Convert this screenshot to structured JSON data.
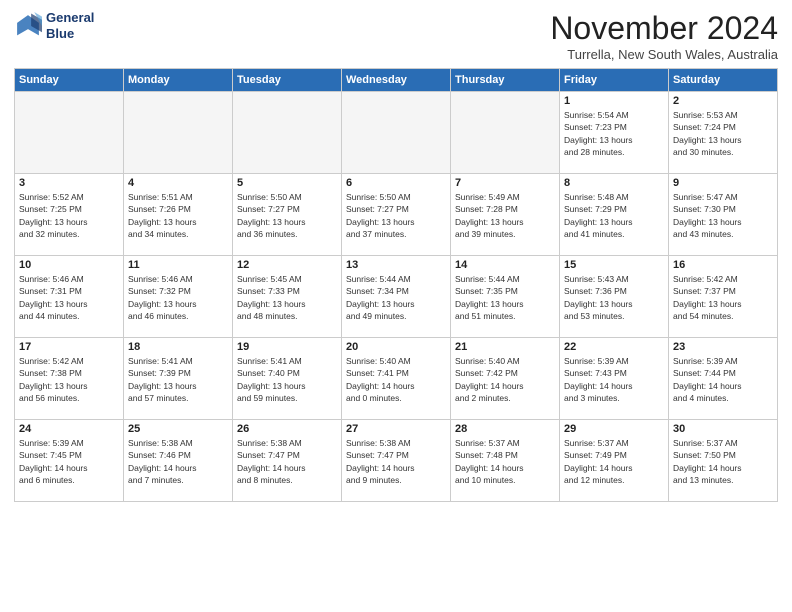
{
  "logo": {
    "line1": "General",
    "line2": "Blue"
  },
  "title": "November 2024",
  "subtitle": "Turrella, New South Wales, Australia",
  "headers": [
    "Sunday",
    "Monday",
    "Tuesday",
    "Wednesday",
    "Thursday",
    "Friday",
    "Saturday"
  ],
  "weeks": [
    [
      {
        "day": "",
        "info": ""
      },
      {
        "day": "",
        "info": ""
      },
      {
        "day": "",
        "info": ""
      },
      {
        "day": "",
        "info": ""
      },
      {
        "day": "",
        "info": ""
      },
      {
        "day": "1",
        "info": "Sunrise: 5:54 AM\nSunset: 7:23 PM\nDaylight: 13 hours\nand 28 minutes."
      },
      {
        "day": "2",
        "info": "Sunrise: 5:53 AM\nSunset: 7:24 PM\nDaylight: 13 hours\nand 30 minutes."
      }
    ],
    [
      {
        "day": "3",
        "info": "Sunrise: 5:52 AM\nSunset: 7:25 PM\nDaylight: 13 hours\nand 32 minutes."
      },
      {
        "day": "4",
        "info": "Sunrise: 5:51 AM\nSunset: 7:26 PM\nDaylight: 13 hours\nand 34 minutes."
      },
      {
        "day": "5",
        "info": "Sunrise: 5:50 AM\nSunset: 7:27 PM\nDaylight: 13 hours\nand 36 minutes."
      },
      {
        "day": "6",
        "info": "Sunrise: 5:50 AM\nSunset: 7:27 PM\nDaylight: 13 hours\nand 37 minutes."
      },
      {
        "day": "7",
        "info": "Sunrise: 5:49 AM\nSunset: 7:28 PM\nDaylight: 13 hours\nand 39 minutes."
      },
      {
        "day": "8",
        "info": "Sunrise: 5:48 AM\nSunset: 7:29 PM\nDaylight: 13 hours\nand 41 minutes."
      },
      {
        "day": "9",
        "info": "Sunrise: 5:47 AM\nSunset: 7:30 PM\nDaylight: 13 hours\nand 43 minutes."
      }
    ],
    [
      {
        "day": "10",
        "info": "Sunrise: 5:46 AM\nSunset: 7:31 PM\nDaylight: 13 hours\nand 44 minutes."
      },
      {
        "day": "11",
        "info": "Sunrise: 5:46 AM\nSunset: 7:32 PM\nDaylight: 13 hours\nand 46 minutes."
      },
      {
        "day": "12",
        "info": "Sunrise: 5:45 AM\nSunset: 7:33 PM\nDaylight: 13 hours\nand 48 minutes."
      },
      {
        "day": "13",
        "info": "Sunrise: 5:44 AM\nSunset: 7:34 PM\nDaylight: 13 hours\nand 49 minutes."
      },
      {
        "day": "14",
        "info": "Sunrise: 5:44 AM\nSunset: 7:35 PM\nDaylight: 13 hours\nand 51 minutes."
      },
      {
        "day": "15",
        "info": "Sunrise: 5:43 AM\nSunset: 7:36 PM\nDaylight: 13 hours\nand 53 minutes."
      },
      {
        "day": "16",
        "info": "Sunrise: 5:42 AM\nSunset: 7:37 PM\nDaylight: 13 hours\nand 54 minutes."
      }
    ],
    [
      {
        "day": "17",
        "info": "Sunrise: 5:42 AM\nSunset: 7:38 PM\nDaylight: 13 hours\nand 56 minutes."
      },
      {
        "day": "18",
        "info": "Sunrise: 5:41 AM\nSunset: 7:39 PM\nDaylight: 13 hours\nand 57 minutes."
      },
      {
        "day": "19",
        "info": "Sunrise: 5:41 AM\nSunset: 7:40 PM\nDaylight: 13 hours\nand 59 minutes."
      },
      {
        "day": "20",
        "info": "Sunrise: 5:40 AM\nSunset: 7:41 PM\nDaylight: 14 hours\nand 0 minutes."
      },
      {
        "day": "21",
        "info": "Sunrise: 5:40 AM\nSunset: 7:42 PM\nDaylight: 14 hours\nand 2 minutes."
      },
      {
        "day": "22",
        "info": "Sunrise: 5:39 AM\nSunset: 7:43 PM\nDaylight: 14 hours\nand 3 minutes."
      },
      {
        "day": "23",
        "info": "Sunrise: 5:39 AM\nSunset: 7:44 PM\nDaylight: 14 hours\nand 4 minutes."
      }
    ],
    [
      {
        "day": "24",
        "info": "Sunrise: 5:39 AM\nSunset: 7:45 PM\nDaylight: 14 hours\nand 6 minutes."
      },
      {
        "day": "25",
        "info": "Sunrise: 5:38 AM\nSunset: 7:46 PM\nDaylight: 14 hours\nand 7 minutes."
      },
      {
        "day": "26",
        "info": "Sunrise: 5:38 AM\nSunset: 7:47 PM\nDaylight: 14 hours\nand 8 minutes."
      },
      {
        "day": "27",
        "info": "Sunrise: 5:38 AM\nSunset: 7:47 PM\nDaylight: 14 hours\nand 9 minutes."
      },
      {
        "day": "28",
        "info": "Sunrise: 5:37 AM\nSunset: 7:48 PM\nDaylight: 14 hours\nand 10 minutes."
      },
      {
        "day": "29",
        "info": "Sunrise: 5:37 AM\nSunset: 7:49 PM\nDaylight: 14 hours\nand 12 minutes."
      },
      {
        "day": "30",
        "info": "Sunrise: 5:37 AM\nSunset: 7:50 PM\nDaylight: 14 hours\nand 13 minutes."
      }
    ]
  ]
}
